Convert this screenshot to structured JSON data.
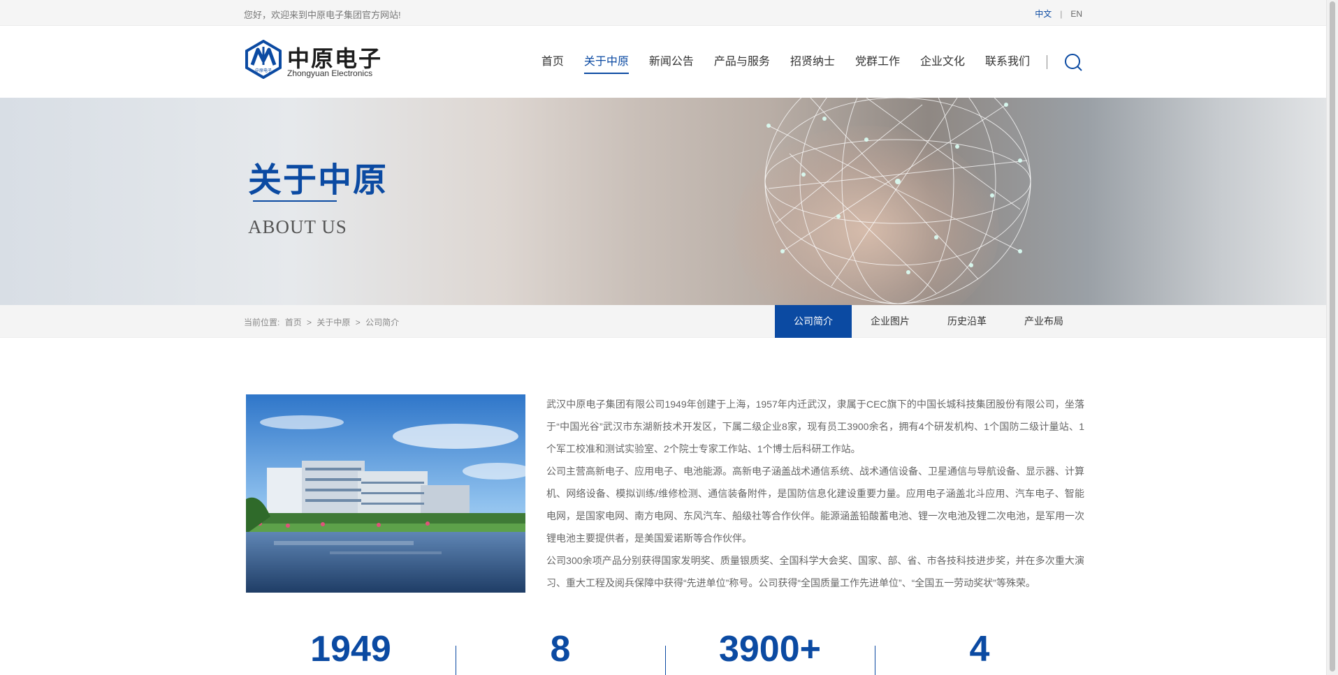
{
  "topbar": {
    "welcome": "您好，欢迎来到中原电子集团官方网站!",
    "lang_cn": "中文",
    "lang_sep": "|",
    "lang_en": "EN"
  },
  "logo": {
    "cn": "中原电子",
    "en": "Zhongyuan Electronics",
    "badge_text": "中原电子"
  },
  "nav": {
    "items": [
      "首页",
      "关于中原",
      "新闻公告",
      "产品与服务",
      "招贤纳士",
      "党群工作",
      "企业文化",
      "联系我们"
    ],
    "active_index": 1
  },
  "banner": {
    "title": "关于中原",
    "subtitle": "ABOUT US"
  },
  "breadcrumb": {
    "prefix": "当前位置:",
    "home": "首页",
    "sep": ">",
    "section": "关于中原",
    "current": "公司简介"
  },
  "subtabs": {
    "items": [
      "公司简介",
      "企业图片",
      "历史沿革",
      "产业布局"
    ],
    "active_index": 0
  },
  "intro": {
    "paragraphs": [
      "武汉中原电子集团有限公司1949年创建于上海，1957年内迁武汉，隶属于CEC旗下的中国长城科技集团股份有限公司，坐落于“中国光谷”武汉市东湖新技术开发区，下属二级企业8家，现有员工3900余名，拥有4个研发机构、1个国防二级计量站、1个军工校准和测试实验室、2个院士专家工作站、1个博士后科研工作站。",
      "公司主营高新电子、应用电子、电池能源。高新电子涵盖战术通信系统、战术通信设备、卫星通信与导航设备、显示器、计算机、网络设备、模拟训练/维修检测、通信装备附件，是国防信息化建设重要力量。应用电子涵盖北斗应用、汽车电子、智能电网，是国家电网、南方电网、东风汽车、船级社等合作伙伴。能源涵盖铅酸蓄电池、锂一次电池及锂二次电池，是军用一次锂电池主要提供者，是美国爱诺斯等合作伙伴。",
      "公司300余项产品分别获得国家发明奖、质量银质奖、全国科学大会奖、国家、部、省、市各技科技进步奖，并在多次重大演习、重大工程及阅兵保障中获得“先进单位”称号。公司获得“全国质量工作先进单位”、“全国五一劳动奖状”等殊荣。"
    ]
  },
  "stats": [
    "1949",
    "8",
    "3900+",
    "4"
  ],
  "colors": {
    "accent": "#0b4aa2",
    "topbar_bg": "#f5f5f5",
    "subbar_bg": "#f4f4f4"
  }
}
